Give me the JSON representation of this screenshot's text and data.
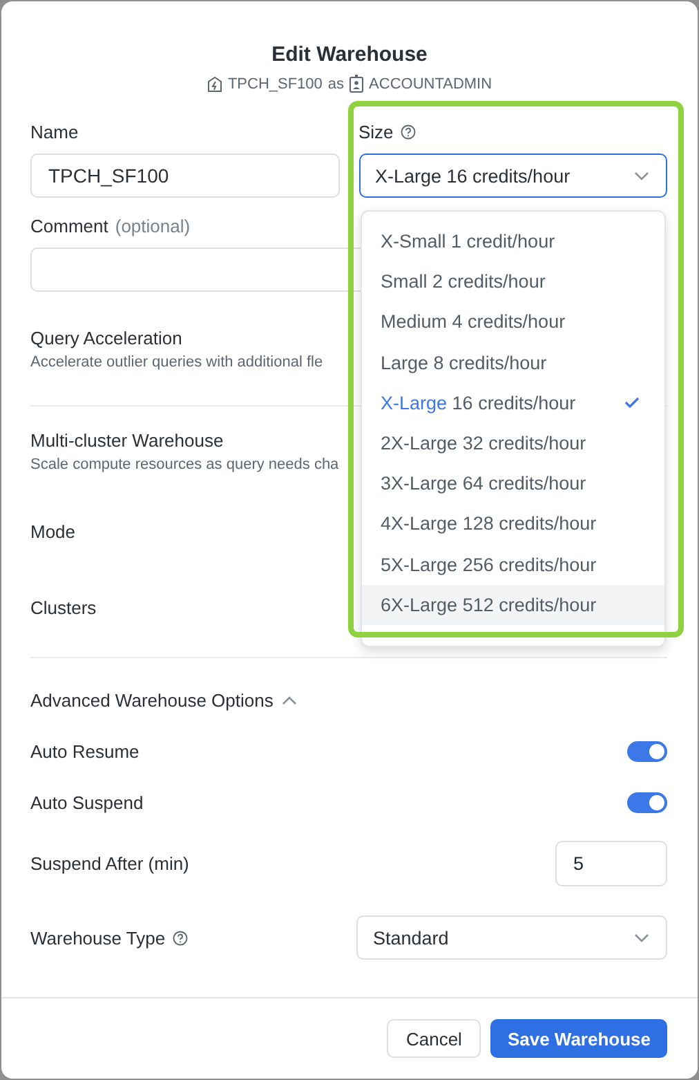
{
  "dialog": {
    "title": "Edit Warehouse",
    "warehouse": "TPCH_SF100",
    "as_word": "as",
    "role": "ACCOUNTADMIN"
  },
  "name_field": {
    "label": "Name",
    "value": "TPCH_SF100"
  },
  "size_field": {
    "label": "Size",
    "value": "X-Large 16 credits/hour",
    "expanded": true,
    "options": [
      {
        "size": "X-Small",
        "credits": "1 credit/hour",
        "selected": false,
        "hovered": false
      },
      {
        "size": "Small",
        "credits": "2 credits/hour",
        "selected": false,
        "hovered": false
      },
      {
        "size": "Medium",
        "credits": "4 credits/hour",
        "selected": false,
        "hovered": false
      },
      {
        "size": "Large",
        "credits": "8 credits/hour",
        "selected": false,
        "hovered": false
      },
      {
        "size": "X-Large",
        "credits": "16 credits/hour",
        "selected": true,
        "hovered": false
      },
      {
        "size": "2X-Large",
        "credits": "32 credits/hour",
        "selected": false,
        "hovered": false
      },
      {
        "size": "3X-Large",
        "credits": "64 credits/hour",
        "selected": false,
        "hovered": false
      },
      {
        "size": "4X-Large",
        "credits": "128 credits/hour",
        "selected": false,
        "hovered": false
      },
      {
        "size": "5X-Large",
        "credits": "256 credits/hour",
        "selected": false,
        "hovered": false
      },
      {
        "size": "6X-Large",
        "credits": "512 credits/hour",
        "selected": false,
        "hovered": true
      }
    ]
  },
  "comment_field": {
    "label": "Comment",
    "hint": "(optional)"
  },
  "query_acceleration": {
    "title": "Query Acceleration",
    "description": "Accelerate outlier queries with additional fle"
  },
  "multi_cluster": {
    "title": "Multi-cluster Warehouse",
    "description": "Scale compute resources as query needs cha"
  },
  "mode": {
    "label": "Mode"
  },
  "clusters": {
    "label": "Clusters"
  },
  "advanced": {
    "title": "Advanced Warehouse Options",
    "expanded": true
  },
  "auto_resume": {
    "label": "Auto Resume",
    "on": true
  },
  "auto_suspend": {
    "label": "Auto Suspend",
    "on": true
  },
  "suspend_after": {
    "label": "Suspend After (min)",
    "value": "5"
  },
  "warehouse_type": {
    "label": "Warehouse Type",
    "value": "Standard"
  },
  "buttons": {
    "cancel": "Cancel",
    "save": "Save Warehouse"
  }
}
